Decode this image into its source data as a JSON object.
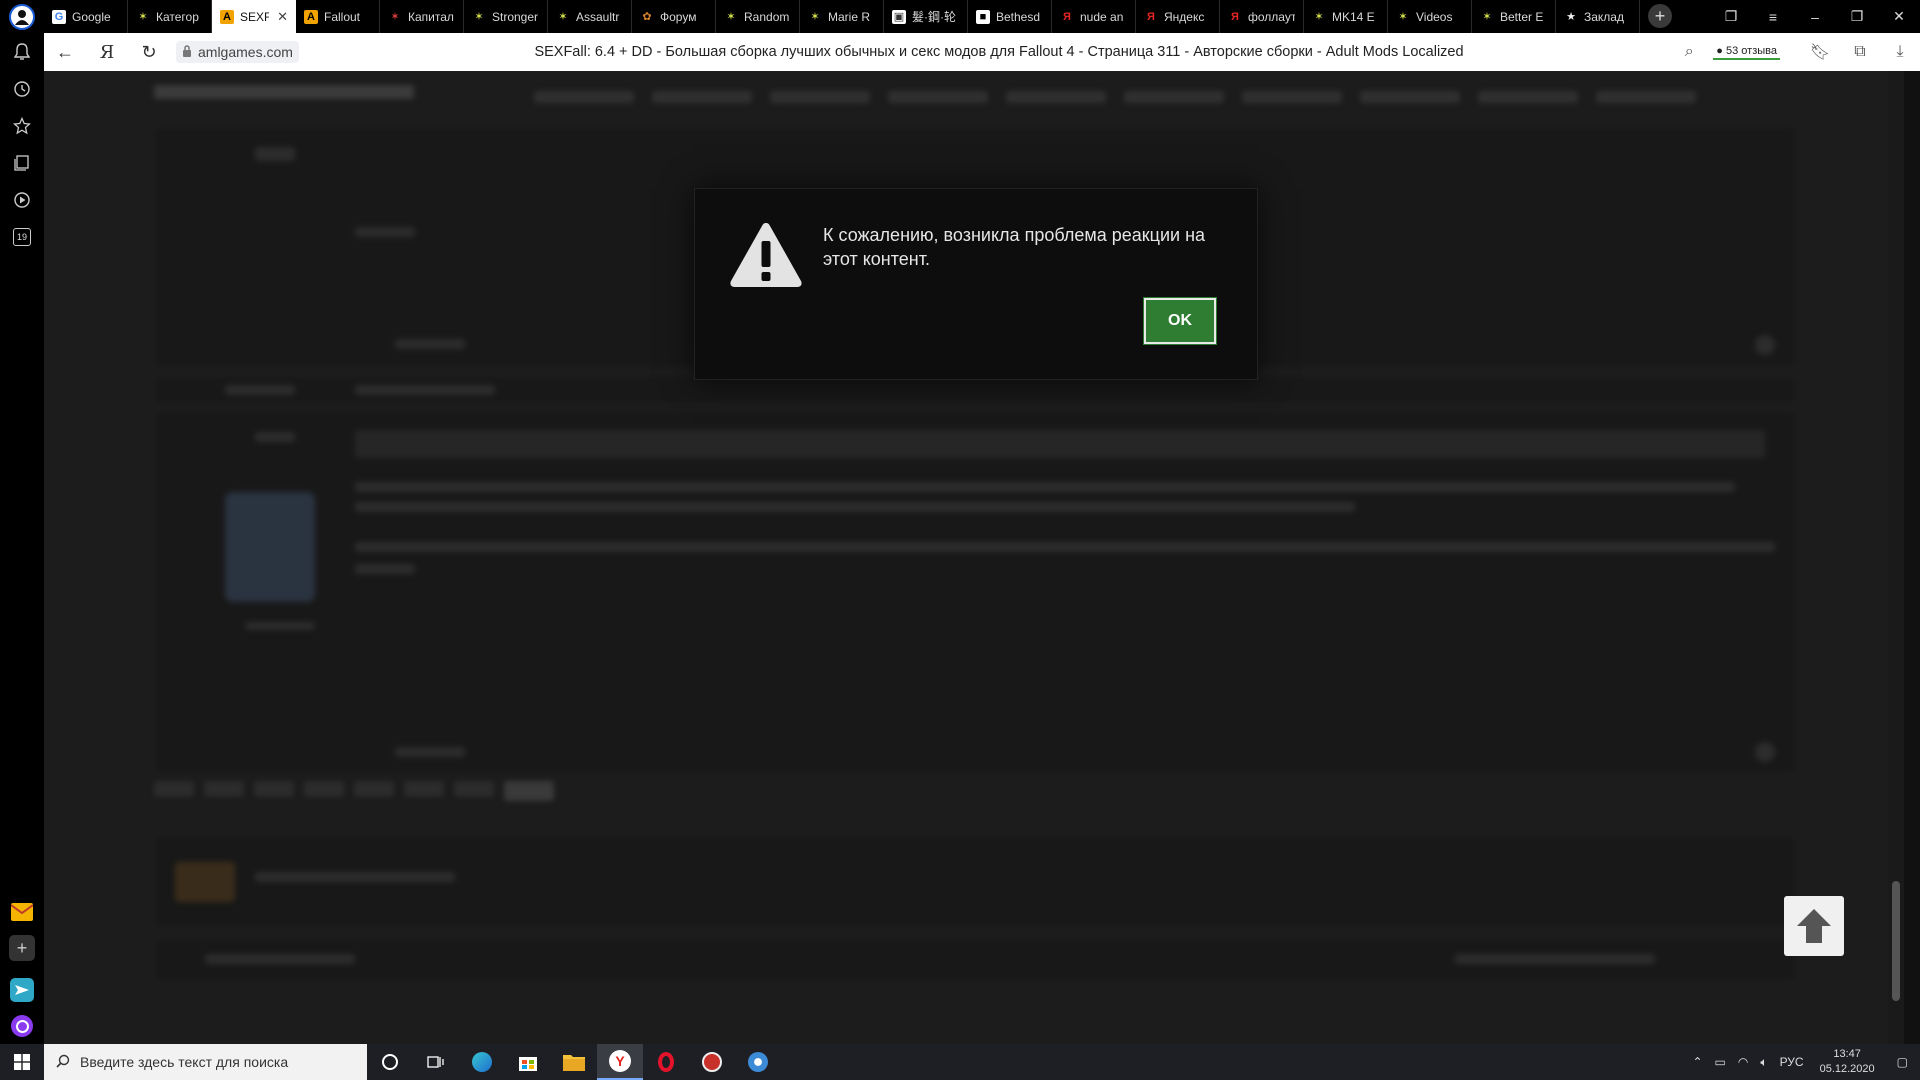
{
  "tabs": [
    {
      "label": "Google",
      "favicon": "google-icon",
      "active": false
    },
    {
      "label": "Категор",
      "favicon": "moddb-icon",
      "active": false
    },
    {
      "label": "SEXFa",
      "favicon": "aml-icon",
      "active": true
    },
    {
      "label": "Fallout",
      "favicon": "aml-icon",
      "active": false
    },
    {
      "label": "Капитал",
      "favicon": "moddb-red-icon",
      "active": false
    },
    {
      "label": "Stronger",
      "favicon": "moddb-icon",
      "active": false
    },
    {
      "label": "Assaultr",
      "favicon": "moddb-icon",
      "active": false
    },
    {
      "label": "Форум",
      "favicon": "forum-icon",
      "active": false
    },
    {
      "label": "Random",
      "favicon": "moddb-icon",
      "active": false
    },
    {
      "label": "Marie R",
      "favicon": "moddb-icon",
      "active": false
    },
    {
      "label": "髮·鋼·轮",
      "favicon": "site-icon",
      "active": false
    },
    {
      "label": "Bethesd",
      "favicon": "bethesda-icon",
      "active": false
    },
    {
      "label": "nude an",
      "favicon": "yandex-icon",
      "active": false
    },
    {
      "label": "Яндекс",
      "favicon": "yandex-icon",
      "active": false
    },
    {
      "label": "фоллаут",
      "favicon": "yandex-icon",
      "active": false
    },
    {
      "label": "MK14 E",
      "favicon": "moddb-icon",
      "active": false
    },
    {
      "label": "Videos",
      "favicon": "moddb-icon",
      "active": false
    },
    {
      "label": "Better E",
      "favicon": "moddb-icon",
      "active": false
    },
    {
      "label": "Заклад",
      "favicon": "star-icon",
      "active": false
    }
  ],
  "address": {
    "domain": "amlgames.com",
    "title": "SEXFall: 6.4 + DD - Большая сборка лучших обычных и секс модов для Fallout 4 - Страница 311 - Авторские сборки - Adult Mods Localized",
    "reviews": "53 отзыва"
  },
  "modal": {
    "message": "К сожалению, возникла проблема реакции на этот контент.",
    "ok_label": "OK"
  },
  "sidebar": {
    "calendar_day": "19"
  },
  "taskbar": {
    "search_placeholder": "Введите здесь текст для поиска",
    "language": "РУС",
    "time": "13:47",
    "date": "05.12.2020"
  },
  "colors": {
    "ok_button": "#2e7d32",
    "overlay": "#1c1c1c",
    "tabstrip": "#000000"
  }
}
